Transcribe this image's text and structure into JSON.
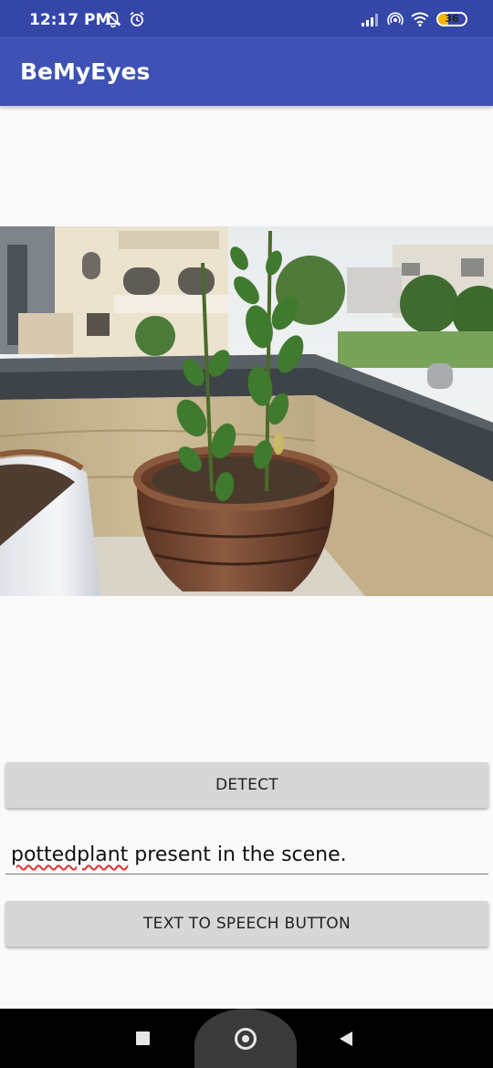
{
  "status_bar": {
    "time": "12:17 PM",
    "left_icons": [
      "muted-bell-icon",
      "alarm-icon"
    ],
    "right_icons": [
      "signal-icon",
      "hotspot-icon",
      "wifi-icon"
    ],
    "battery_level": "36"
  },
  "app_bar": {
    "title": "BeMyEyes"
  },
  "image": {
    "description_icon": "potted-plant-photo"
  },
  "buttons": {
    "detect_label": "DETECT",
    "tts_label": "TEXT TO SPEECH BUTTON"
  },
  "result": {
    "misspelled_word": "pottedplant",
    "rest": " present in the scene."
  },
  "nav_bar": {
    "icons": [
      "recents-icon",
      "home-icon",
      "back-icon"
    ]
  },
  "colors": {
    "primary": "#3f51b5",
    "primary_dark": "#3446a8",
    "button": "#d7d7d7",
    "background": "#fafafa"
  }
}
